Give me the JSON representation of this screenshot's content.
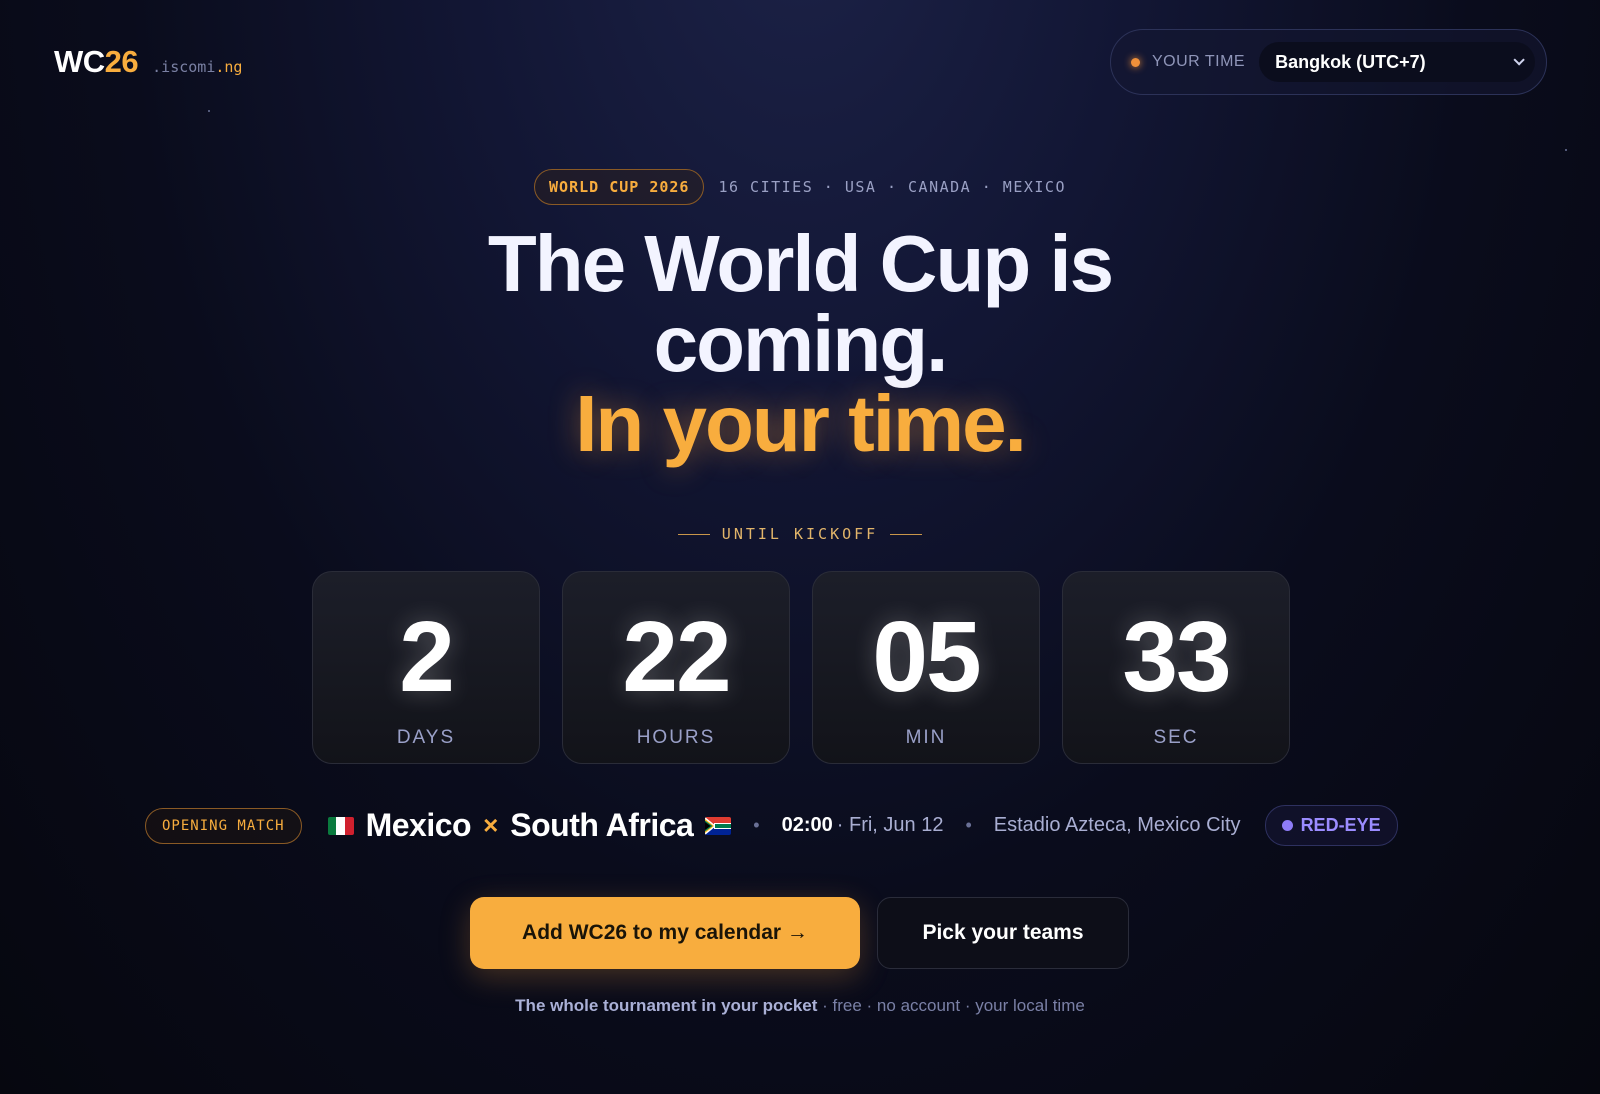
{
  "header": {
    "logo_main": "WC",
    "logo_accent": "26",
    "logo_domain": ".iscomi",
    "logo_tld": ".ng",
    "timezone_label": "YOUR TIME",
    "timezone_value": "Bangkok (UTC+7)"
  },
  "eyebrow": {
    "badge": "WORLD CUP 2026",
    "text": "16 CITIES · USA · CANADA · MEXICO"
  },
  "headline": {
    "line1": "The World Cup is",
    "line2": "coming.",
    "line3": "In your time."
  },
  "countdown": {
    "label": "UNTIL KICKOFF",
    "units": [
      {
        "value": "2",
        "label": "DAYS"
      },
      {
        "value": "22",
        "label": "HOURS"
      },
      {
        "value": "05",
        "label": "MIN"
      },
      {
        "value": "33",
        "label": "SEC"
      }
    ]
  },
  "match": {
    "badge": "OPENING MATCH",
    "home": "Mexico",
    "vs": "×",
    "away": "South Africa",
    "sep": "•",
    "time": "02:00",
    "date": "· Fri, Jun 12",
    "venue": "Estadio Azteca, Mexico City",
    "tag": "RED-EYE"
  },
  "cta": {
    "primary": "Add WC26 to my calendar →",
    "secondary": "Pick your teams"
  },
  "tagline": {
    "strong": "The whole tournament in your pocket",
    "rest": " · free · no account · your local time"
  },
  "colors": {
    "accent": "#f8ad3e",
    "red_eye": "#9b8cff"
  },
  "icons": [
    "chevron-down-icon",
    "mexico-flag-icon",
    "south-africa-flag-icon"
  ]
}
